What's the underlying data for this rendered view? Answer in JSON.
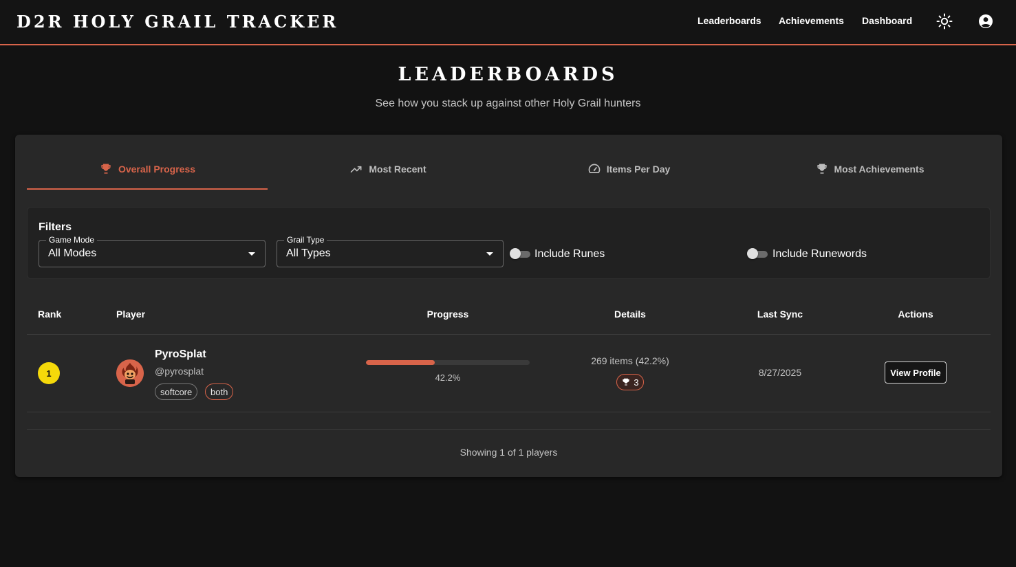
{
  "header": {
    "title": "D2R HOLY GRAIL TRACKER",
    "nav": [
      "Leaderboards",
      "Achievements",
      "Dashboard"
    ],
    "theme_icon": "sun-icon",
    "account_icon": "account-circle-icon"
  },
  "page": {
    "title": "LEADERBOARDS",
    "subtitle": "See how you stack up against other Holy Grail hunters"
  },
  "tabs": [
    {
      "label": "Overall Progress",
      "icon": "trophy-icon",
      "active": true
    },
    {
      "label": "Most Recent",
      "icon": "trending-up-icon",
      "active": false
    },
    {
      "label": "Items Per Day",
      "icon": "speedometer-icon",
      "active": false
    },
    {
      "label": "Most Achievements",
      "icon": "trophy-icon",
      "active": false
    }
  ],
  "filters": {
    "title": "Filters",
    "game_mode": {
      "label": "Game Mode",
      "value": "All Modes"
    },
    "grail_type": {
      "label": "Grail Type",
      "value": "All Types"
    },
    "include_runes": {
      "label": "Include Runes",
      "checked": false
    },
    "include_runewords": {
      "label": "Include Runewords",
      "checked": false
    }
  },
  "table": {
    "columns": [
      "Rank",
      "Player",
      "Progress",
      "Details",
      "Last Sync",
      "Actions"
    ],
    "rows": [
      {
        "rank": "1",
        "name": "PyroSplat",
        "handle": "@pyrosplat",
        "tags": [
          "softcore",
          "both"
        ],
        "progress_pct": 42.2,
        "progress_text": "42.2%",
        "details": "269 items (42.2%)",
        "achievements": "3",
        "last_sync": "8/27/2025",
        "action": "View Profile"
      }
    ]
  },
  "footer": {
    "text": "Showing 1 of 1 players"
  },
  "colors": {
    "accent": "#d8644a",
    "gold": "#f5d90a",
    "background": "#121212",
    "card": "#282828"
  }
}
